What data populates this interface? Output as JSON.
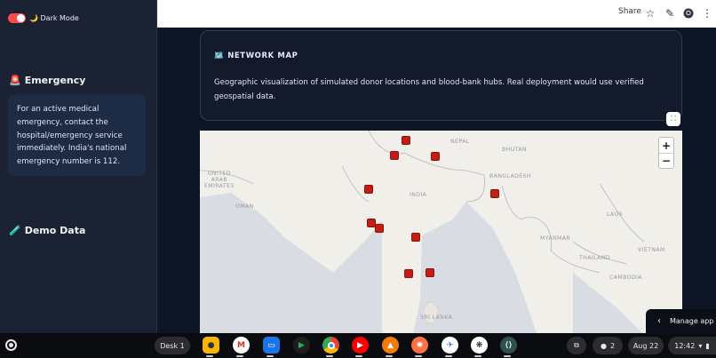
{
  "sidebar": {
    "toggle_label": "🌙 Dark Mode",
    "emergency_title": "Emergency",
    "emergency_icon": "🚨",
    "emergency_text": "For an active medical emergency, contact the hospital/emergency service immediately. India's national emergency number is 112.",
    "demo_title": "Demo Data",
    "demo_icon": "🧪"
  },
  "header": {
    "share_label": "Share"
  },
  "main": {
    "card_icon": "🗺️",
    "card_title": "NETWORK MAP",
    "card_desc": "Geographic visualization of simulated donor locations and blood-bank hubs. Real deployment would use verified geospatial data."
  },
  "map": {
    "zoom_in": "+",
    "zoom_out": "−",
    "labels": {
      "nepal": "NEPAL",
      "bhutan": "BHUTAN",
      "uae": "UNITED\nARAB\nEMIRATES",
      "bangladesh": "BANGLADESH",
      "india": "INDIA",
      "oman": "OMAN",
      "laos": "LAOS",
      "myanmar": "MYANMAR",
      "vietnam": "VIETNAM",
      "thailand": "THAILAND",
      "cambodia": "CAMBODIA",
      "srilanka": "SRI LANKA"
    },
    "marker_color": "#c41d12"
  },
  "manage_app": "Manage app",
  "shelf": {
    "desk": "Desk 1",
    "notifications": "2",
    "date": "Aug 22",
    "time": "12:42"
  },
  "colors": {
    "accent": "#ff4b4b",
    "sidebar_bg": "#1a2233",
    "main_bg": "#0e1525"
  }
}
